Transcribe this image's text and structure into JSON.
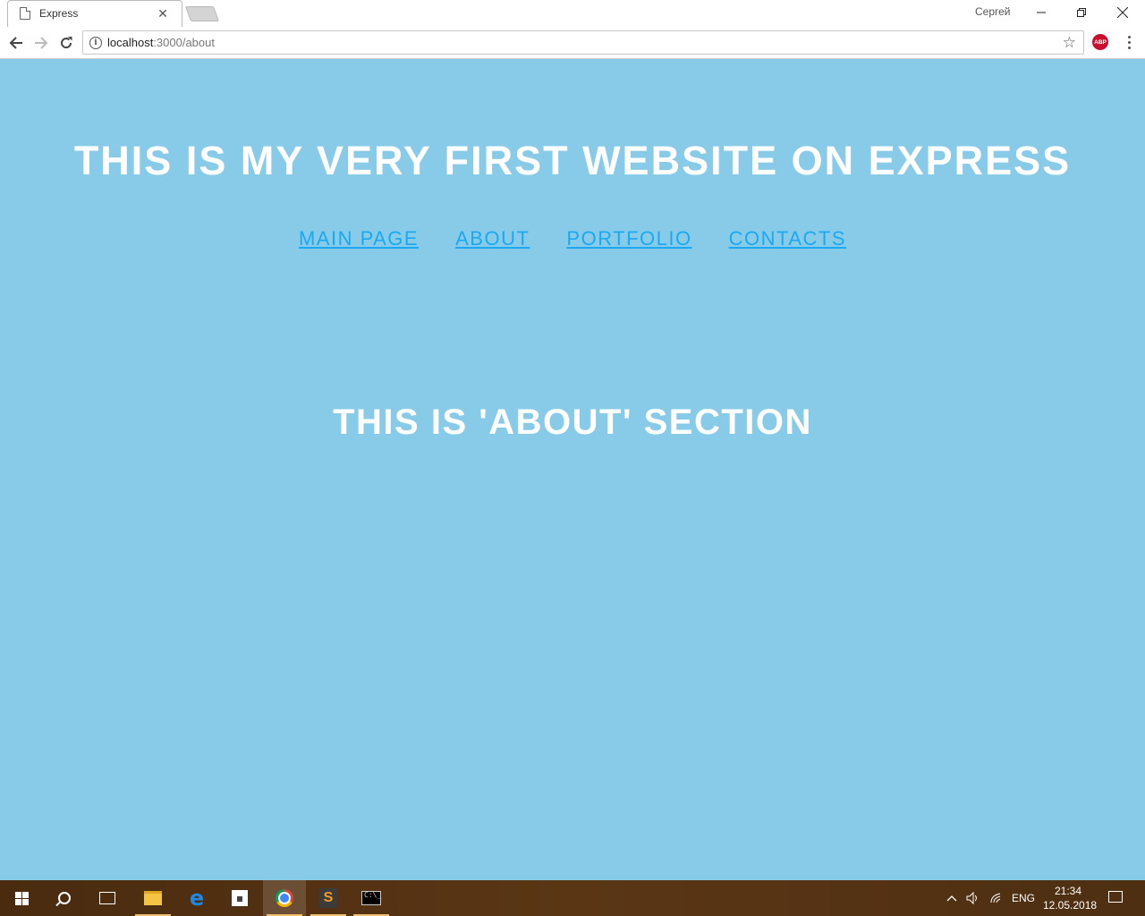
{
  "browser": {
    "tab": {
      "title": "Express"
    },
    "profile_name": "Сергей",
    "address": {
      "host": "localhost",
      "path": ":3000/about"
    },
    "extension_label": "ABP"
  },
  "page": {
    "site_title": "THIS IS MY VERY FIRST WEBSITE ON EXPRESS",
    "nav": [
      {
        "label": "MAIN PAGE"
      },
      {
        "label": "ABOUT"
      },
      {
        "label": "PORTFOLIO"
      },
      {
        "label": "CONTACTS"
      }
    ],
    "section_title": "THIS IS 'ABOUT' SECTION",
    "background_color": "#87cbe8",
    "link_color": "#1aa9f2"
  },
  "taskbar": {
    "language": "ENG",
    "time": "21:34",
    "date": "12.05.2018"
  }
}
